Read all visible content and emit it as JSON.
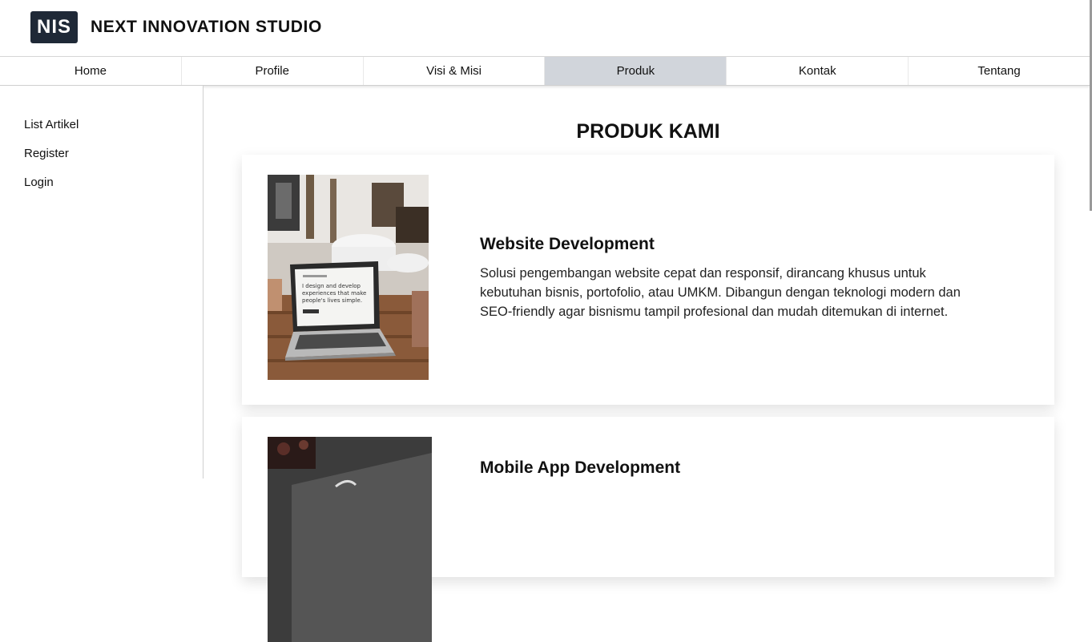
{
  "header": {
    "logo_text": "NIS",
    "brand_name": "NEXT INNOVATION STUDIO"
  },
  "nav": {
    "items": [
      {
        "label": "Home"
      },
      {
        "label": "Profile"
      },
      {
        "label": "Visi & Misi"
      },
      {
        "label": "Produk"
      },
      {
        "label": "Kontak"
      },
      {
        "label": "Tentang"
      }
    ],
    "active_index": 3,
    "active_color": "#d1d5db"
  },
  "sidebar": {
    "items": [
      {
        "label": "List Artikel"
      },
      {
        "label": "Register"
      },
      {
        "label": "Login"
      }
    ]
  },
  "main": {
    "title": "PRODUK KAMI",
    "products": [
      {
        "image_icon": "laptop-photo",
        "image_text": "I design and develop experiences that make people's lives simple.",
        "title": "Website Development",
        "description": "Solusi pengembangan website cepat dan responsif, dirancang khusus untuk kebutuhan bisnis, portofolio, atau UMKM. Dibangun dengan teknologi modern dan SEO-friendly agar bisnismu tampil profesional dan mudah ditemukan di internet."
      },
      {
        "image_icon": "phone-photo",
        "title": "Mobile App Development"
      }
    ]
  },
  "colors": {
    "logo_bg": "#1f2937",
    "active_tab": "#d1d5db"
  }
}
